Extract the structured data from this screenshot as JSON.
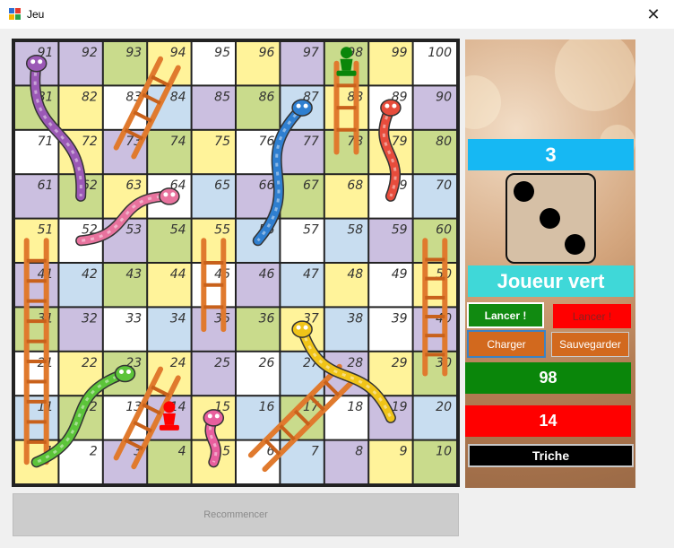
{
  "window": {
    "title": "Jeu",
    "close_glyph": "✕"
  },
  "board": {
    "rows": [
      [
        "91",
        "92",
        "93",
        "94",
        "95",
        "96",
        "97",
        "98",
        "99",
        "100"
      ],
      [
        "81",
        "82",
        "83",
        "84",
        "85",
        "86",
        "87",
        "88",
        "89",
        "90"
      ],
      [
        "71",
        "72",
        "73",
        "74",
        "75",
        "76",
        "77",
        "78",
        "79",
        "80"
      ],
      [
        "61",
        "62",
        "63",
        "64",
        "65",
        "66",
        "67",
        "68",
        "69",
        "70"
      ],
      [
        "51",
        "52",
        "53",
        "54",
        "55",
        "56",
        "57",
        "58",
        "59",
        "60"
      ],
      [
        "41",
        "42",
        "43",
        "44",
        "45",
        "46",
        "47",
        "48",
        "49",
        "50"
      ],
      [
        "31",
        "32",
        "33",
        "34",
        "35",
        "36",
        "37",
        "38",
        "39",
        "40"
      ],
      [
        "21",
        "22",
        "23",
        "24",
        "25",
        "26",
        "27",
        "28",
        "29",
        "30"
      ],
      [
        "11",
        "12",
        "13",
        "14",
        "15",
        "16",
        "17",
        "18",
        "19",
        "20"
      ],
      [
        "1",
        "2",
        "3",
        "4",
        "5",
        "6",
        "7",
        "8",
        "9",
        "10"
      ]
    ],
    "ladders": [
      {
        "from": 73,
        "to": 94
      },
      {
        "from": 78,
        "to": 98
      },
      {
        "from": 30,
        "to": 60
      },
      {
        "from": 1,
        "to": 51
      },
      {
        "from": 35,
        "to": 55
      },
      {
        "from": 3,
        "to": 24
      },
      {
        "from": 6,
        "to": 28
      }
    ],
    "snakes": [
      {
        "head": 91,
        "tail": 62,
        "color": "#9b59b6"
      },
      {
        "head": 87,
        "tail": 56,
        "color": "#2f7fd0"
      },
      {
        "head": 89,
        "tail": 69,
        "color": "#e74c3c"
      },
      {
        "head": 64,
        "tail": 52,
        "color": "#e8739e"
      },
      {
        "head": 37,
        "tail": 19,
        "color": "#f0c419"
      },
      {
        "head": 23,
        "tail": 1,
        "color": "#5cc43a"
      },
      {
        "head": 15,
        "tail": 5,
        "color": "#e85f9e"
      }
    ],
    "pawns": [
      {
        "color": "green",
        "square": 98
      },
      {
        "color": "red",
        "square": 14
      }
    ]
  },
  "panel": {
    "dice_value": "3",
    "current_player": "Joueur vert",
    "buttons": {
      "lancer_green": "Lancer !",
      "lancer_red": "Lancer !",
      "charger": "Charger",
      "sauvegarder": "Sauvegarder",
      "triche": "Triche"
    },
    "score_green": "98",
    "score_red": "14"
  },
  "footer": {
    "restart_label": "Recommencer"
  },
  "colors": {
    "yellow": "#fff39a",
    "white": "#ffffff",
    "lavender": "#cbbfe0",
    "green": "#c9db8c",
    "blue": "#c8ddf0"
  }
}
